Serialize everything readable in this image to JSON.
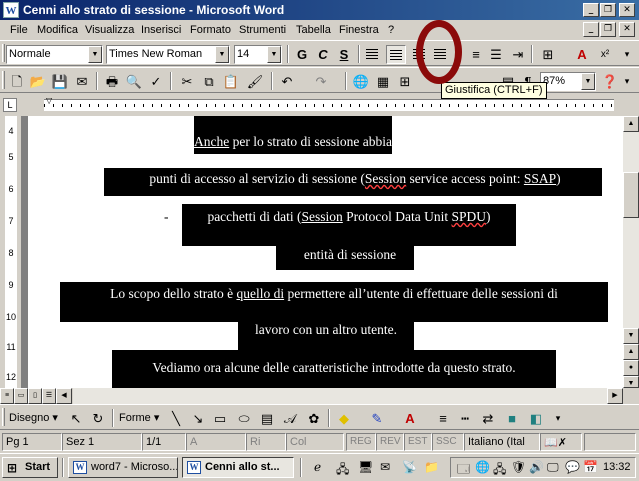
{
  "window": {
    "title": "Cenni allo strato di sessione - Microsoft Word"
  },
  "menu": [
    "File",
    "Modifica",
    "Visualizza",
    "Inserisci",
    "Formato",
    "Strumenti",
    "Tabella",
    "Finestra",
    "?"
  ],
  "formatting": {
    "style": "Normale",
    "font": "Times New Roman",
    "size": "14",
    "bold": "G",
    "italic": "C",
    "underline": "S"
  },
  "standard": {
    "zoom": "87%"
  },
  "tooltip": "Giustifica (CTRL+F)",
  "vruler_numbers": [
    "4",
    "5",
    "6",
    "7",
    "8",
    "9",
    "10",
    "11",
    "12"
  ],
  "document": {
    "lines": [
      {
        "pre": "",
        "u": "Anche",
        "post": " per lo strato di sessione abbiamo"
      },
      {
        "bullet": "-",
        "text_parts": [
          "punti di accesso al servizio di sessione (",
          "Session",
          " service access point: ",
          "SSAP",
          ")"
        ]
      },
      {
        "bullet": "-",
        "text_parts": [
          "pacchetti di dati (",
          "Session",
          " Protocol Data Unit ",
          "SPDU",
          ")"
        ]
      },
      {
        "bullet": "-",
        "text": "entità di sessione"
      },
      {
        "text_parts": [
          "Lo scopo dello strato è ",
          "quello di",
          " permettere all’utente di effettuare delle sessioni di"
        ]
      },
      {
        "text": "lavoro con un altro utente."
      },
      {
        "text": "Vediamo ora alcune delle caratteristiche introdotte da questo strato."
      }
    ]
  },
  "drawing": {
    "draw": "Disegno",
    "shapes": "Forme"
  },
  "status": {
    "page": "Pg 1",
    "section": "Sez 1",
    "pages": "1/1",
    "at": "A",
    "line": "Ri",
    "col": "Col",
    "rec": "REG",
    "rev": "REV",
    "ext": "EST",
    "ovr": "SSC",
    "language": "Italiano (Ital"
  },
  "taskbar": {
    "start": "Start",
    "tasks": [
      "word7 - Microso...",
      "Cenni allo st..."
    ],
    "clock": "13:32"
  }
}
